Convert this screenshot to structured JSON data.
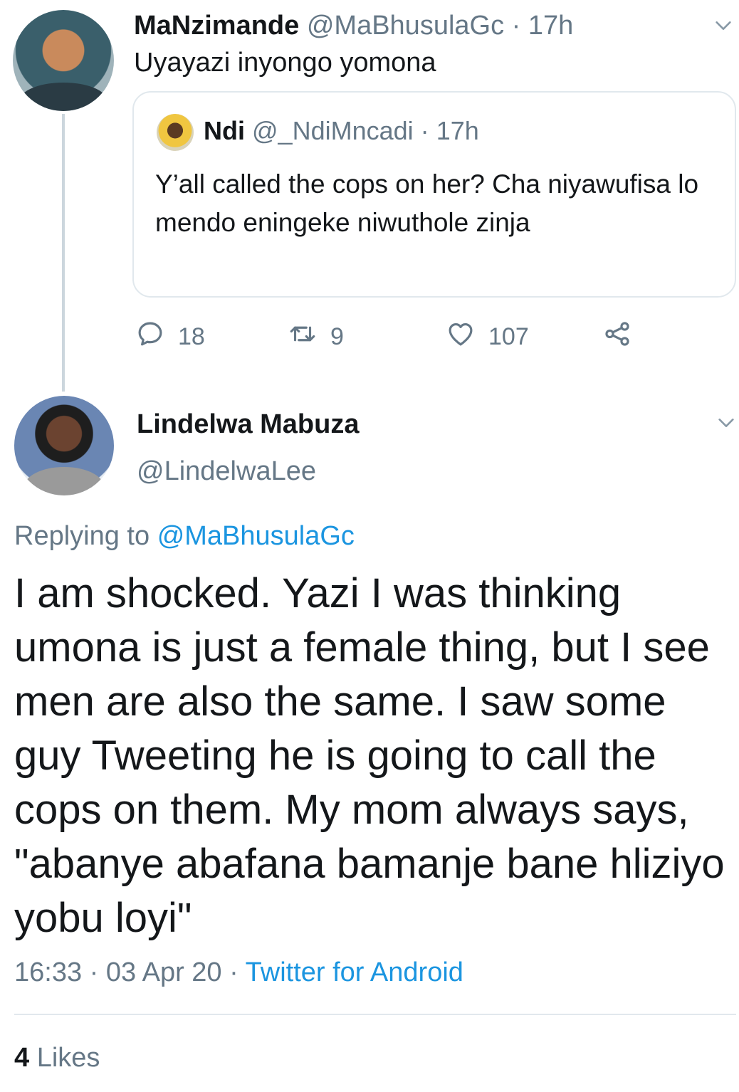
{
  "parent_tweet": {
    "display_name": "MaNzimande",
    "handle": "@MaBhusulaGc",
    "separator": "·",
    "time": "17h",
    "text": "Uyayazi inyongo yomona",
    "quoted_tweet": {
      "display_name": "Ndi",
      "handle": "@_NdiMncadi",
      "separator": "·",
      "time": "17h",
      "text": "Y’all called the cops on her? Cha niyawufisa lo mendo eningeke niwuthole zinja"
    },
    "actions": {
      "reply_count": "18",
      "retweet_count": "9",
      "like_count": "107"
    },
    "icons": [
      "chevron-down-icon",
      "reply-icon",
      "retweet-icon",
      "like-icon",
      "share-icon"
    ]
  },
  "reply_tweet": {
    "display_name": "Lindelwa Mabuza",
    "handle": "@LindelwaLee",
    "replying_to_label": "Replying to",
    "replying_to_handle": "@MaBhusulaGc",
    "text": "I am shocked. Yazi I was thinking umona is just a female thing, but I see men are also the same. I saw some guy Tweeting he is going to call the cops on them. My mom always says, \"abanye abafana bamanje bane hliziyo yobu loyi\"",
    "time": "16:33",
    "date": "03 Apr 20",
    "separator": "·",
    "source": "Twitter for Android",
    "likes_count": "4",
    "likes_label": "Likes"
  },
  "colors": {
    "link": "#1b95e0",
    "muted": "#657786",
    "text": "#14171a",
    "border": "#e1e8ed",
    "thread_line": "#ccd6dd"
  }
}
